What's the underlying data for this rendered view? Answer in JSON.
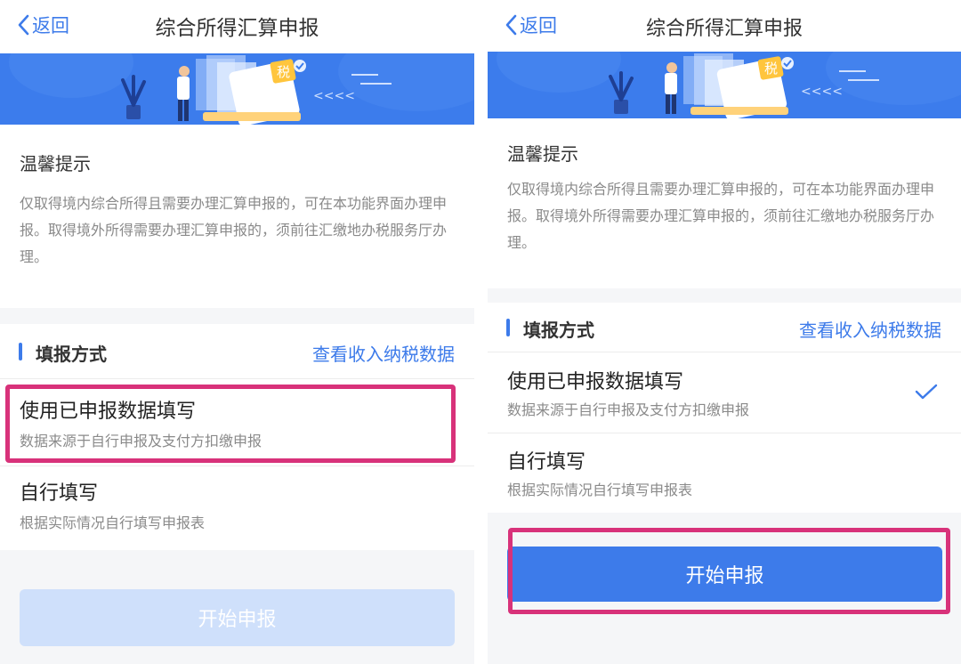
{
  "left": {
    "nav": {
      "back_label": "返回",
      "title": "综合所得汇算申报"
    },
    "banner": {
      "badge_text": "税",
      "arrows_text": "<<<<"
    },
    "tips": {
      "title": "温馨提示",
      "body": "仅取得境内综合所得且需要办理汇算申报的，可在本功能界面办理申报。取得境外所得需要办理汇算申报的，须前往汇缴地办税服务厅办理。"
    },
    "method": {
      "title": "填报方式",
      "link": "查看收入纳税数据",
      "options": [
        {
          "label": "使用已申报数据填写",
          "desc": "数据来源于自行申报及支付方扣缴申报",
          "selected": false
        },
        {
          "label": "自行填写",
          "desc": "根据实际情况自行填写申报表",
          "selected": false
        }
      ]
    },
    "start_button": {
      "label": "开始申报",
      "state": "disabled"
    }
  },
  "right": {
    "nav": {
      "back_label": "返回",
      "title": "综合所得汇算申报"
    },
    "banner": {
      "badge_text": "税",
      "arrows_text": "<<<<"
    },
    "tips": {
      "title": "温馨提示",
      "body": "仅取得境内综合所得且需要办理汇算申报的，可在本功能界面办理申报。取得境外所得需要办理汇算申报的，须前往汇缴地办税服务厅办理。"
    },
    "method": {
      "title": "填报方式",
      "link": "查看收入纳税数据",
      "options": [
        {
          "label": "使用已申报数据填写",
          "desc": "数据来源于自行申报及支付方扣缴申报",
          "selected": true
        },
        {
          "label": "自行填写",
          "desc": "根据实际情况自行填写申报表",
          "selected": false
        }
      ]
    },
    "start_button": {
      "label": "开始申报",
      "state": "enabled"
    }
  },
  "colors": {
    "accent": "#3d7bea",
    "banner": "#3c7cec",
    "highlight": "#d8327a",
    "disabled_button": "#cfe0fb"
  }
}
